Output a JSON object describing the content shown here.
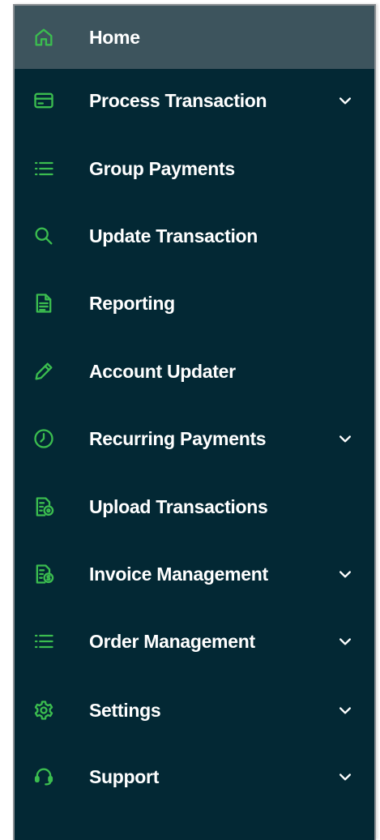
{
  "theme": {
    "sidebar_bg": "#032834",
    "active_bg": "#3d545d",
    "icon_color": "#3bbd4f",
    "text_color": "#ffffff"
  },
  "nav": {
    "items": [
      {
        "label": "Home",
        "icon": "home-icon",
        "active": true,
        "expandable": false
      },
      {
        "label": "Process Transaction",
        "icon": "credit-card-icon",
        "active": false,
        "expandable": true
      },
      {
        "label": "Group Payments",
        "icon": "list-icon",
        "active": false,
        "expandable": false
      },
      {
        "label": "Update Transaction",
        "icon": "search-icon",
        "active": false,
        "expandable": false
      },
      {
        "label": "Reporting",
        "icon": "document-icon",
        "active": false,
        "expandable": false
      },
      {
        "label": "Account Updater",
        "icon": "pencil-icon",
        "active": false,
        "expandable": false
      },
      {
        "label": "Recurring Payments",
        "icon": "clock-icon",
        "active": false,
        "expandable": true
      },
      {
        "label": "Upload Transactions",
        "icon": "document-upload-icon",
        "active": false,
        "expandable": false
      },
      {
        "label": "Invoice Management",
        "icon": "invoice-icon",
        "active": false,
        "expandable": true
      },
      {
        "label": "Order Management",
        "icon": "list-icon",
        "active": false,
        "expandable": true
      },
      {
        "label": "Settings",
        "icon": "gear-icon",
        "active": false,
        "expandable": true
      },
      {
        "label": "Support",
        "icon": "headset-icon",
        "active": false,
        "expandable": true
      }
    ]
  }
}
